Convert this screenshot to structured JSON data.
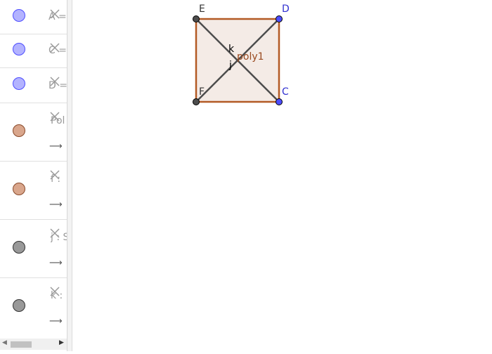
{
  "algebra": {
    "rows": [
      {
        "label": "A =",
        "color": "#b3b3ff"
      },
      {
        "label": "C =",
        "color": "#b3b3ff"
      },
      {
        "label": "D =",
        "color": "#b3b3ff"
      },
      {
        "label": "Pol",
        "color": "#d9a68c",
        "dependent": true
      },
      {
        "label": "f :",
        "color": "#d9a68c",
        "dependent": true
      },
      {
        "label": "j : S",
        "color": "#999999",
        "dependent": true
      },
      {
        "label": "k :",
        "color": "#999999",
        "dependent": true
      }
    ],
    "arrow_glyph": "⟶"
  },
  "graphics": {
    "points": {
      "E": "E",
      "D": "D",
      "F": "F",
      "C": "C"
    },
    "polygon_label": "poly1",
    "segment_k": "k",
    "segment_j": "j",
    "colors": {
      "polygon_fill": "#f4ebe6",
      "polygon_edge": "#b35a24",
      "diagonal": "#4d4d4d",
      "free_point": "#4d4dff",
      "dependent_point": "#4d4d4d",
      "free_label": "#3030d0",
      "polygon_label": "#9a4a1f"
    }
  }
}
